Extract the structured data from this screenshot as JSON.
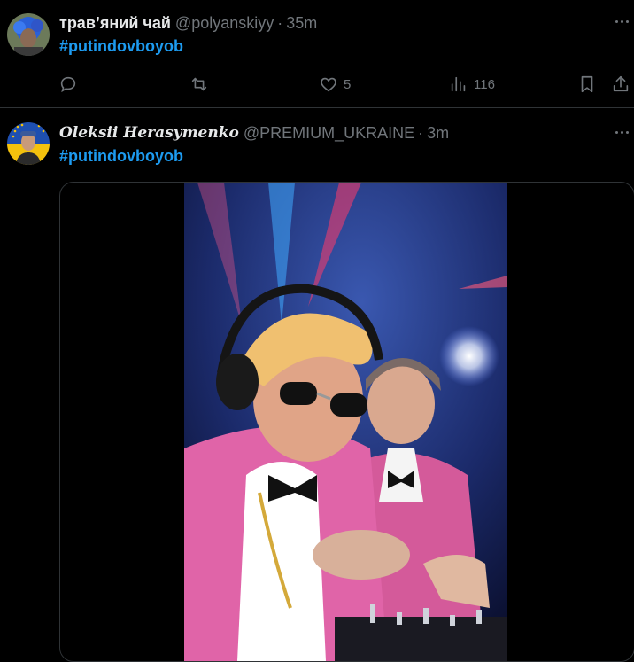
{
  "tweets": [
    {
      "display_name": "трав’яний чай",
      "handle": "@polyanskiyy",
      "separator": "·",
      "time": "35m",
      "text": "#putindovboyob",
      "actions": {
        "reply_icon": "reply-icon",
        "retweet_icon": "retweet-icon",
        "like_icon": "heart-icon",
        "like_count": "5",
        "views_icon": "views-chart-icon",
        "view_count": "116",
        "bookmark_icon": "bookmark-icon",
        "share_icon": "share-icon"
      }
    },
    {
      "display_name": "𝑶𝒍𝒆𝒌𝒔𝒊𝒊 𝑯𝒆𝒓𝒂𝒔𝒚𝒎𝒆𝒏𝒌𝒐",
      "handle": "@PREMIUM_UKRAINE",
      "separator": "·",
      "time": "3m",
      "text": "#putindovboyob"
    }
  ],
  "colors": {
    "link": "#1d9bf0",
    "muted": "#71767b",
    "text": "#e7e9ea",
    "border": "#2f3336",
    "background": "#000000"
  }
}
